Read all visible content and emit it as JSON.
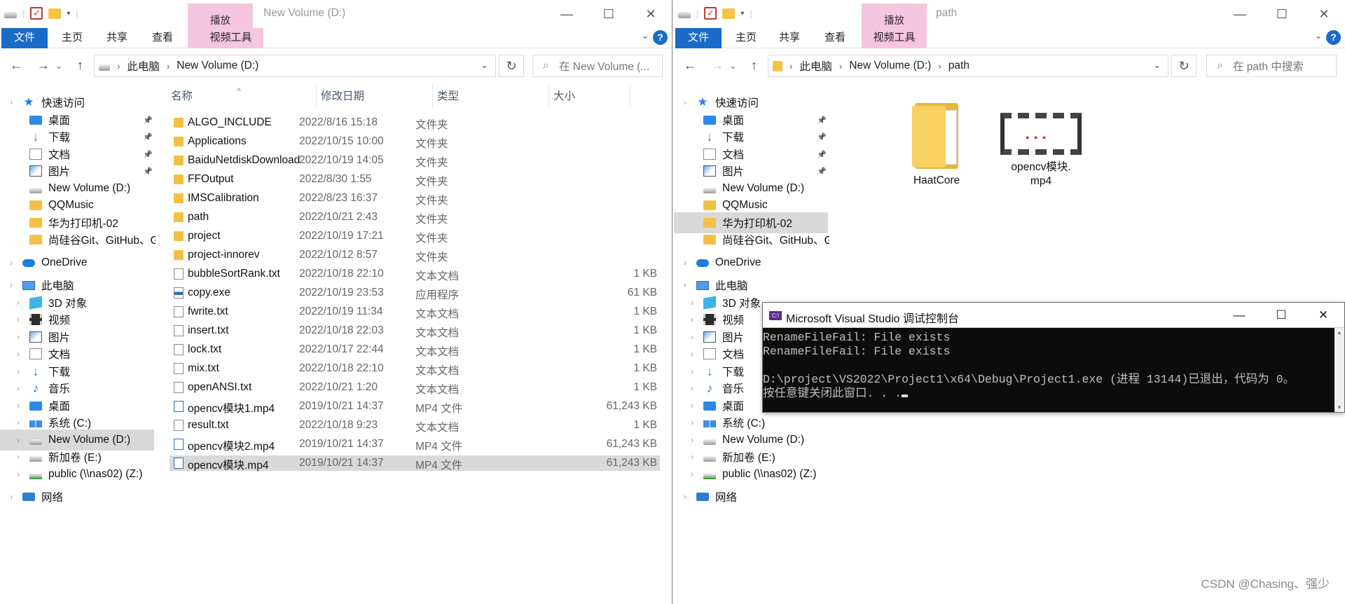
{
  "left": {
    "ribbon_context": "播放",
    "title": "New Volume (D:)",
    "tabs": [
      "文件",
      "主页",
      "共享",
      "查看",
      "视频工具"
    ],
    "breadcrumb": [
      "此电脑",
      "New Volume (D:)"
    ],
    "search_placeholder": "在 New Volume (...",
    "columns": {
      "name": "名称",
      "date": "修改日期",
      "type": "类型",
      "size": "大小"
    },
    "files": [
      {
        "name": "ALGO_INCLUDE",
        "date": "2022/8/16 15:18",
        "type": "文件夹",
        "size": "",
        "icon": "folder"
      },
      {
        "name": "Applications",
        "date": "2022/10/15 10:00",
        "type": "文件夹",
        "size": "",
        "icon": "folder"
      },
      {
        "name": "BaiduNetdiskDownload",
        "date": "2022/10/19 14:05",
        "type": "文件夹",
        "size": "",
        "icon": "folder"
      },
      {
        "name": "FFOutput",
        "date": "2022/8/30 1:55",
        "type": "文件夹",
        "size": "",
        "icon": "folder"
      },
      {
        "name": "IMSCalibration",
        "date": "2022/8/23 16:37",
        "type": "文件夹",
        "size": "",
        "icon": "folder"
      },
      {
        "name": "path",
        "date": "2022/10/21 2:43",
        "type": "文件夹",
        "size": "",
        "icon": "folder"
      },
      {
        "name": "project",
        "date": "2022/10/19 17:21",
        "type": "文件夹",
        "size": "",
        "icon": "folder"
      },
      {
        "name": "project-innorev",
        "date": "2022/10/12 8:57",
        "type": "文件夹",
        "size": "",
        "icon": "folder"
      },
      {
        "name": "bubbleSortRank.txt",
        "date": "2022/10/18 22:10",
        "type": "文本文档",
        "size": "1 KB",
        "icon": "txt"
      },
      {
        "name": "copy.exe",
        "date": "2022/10/19 23:53",
        "type": "应用程序",
        "size": "61 KB",
        "icon": "exe"
      },
      {
        "name": "fwrite.txt",
        "date": "2022/10/19 11:34",
        "type": "文本文档",
        "size": "1 KB",
        "icon": "txt"
      },
      {
        "name": "insert.txt",
        "date": "2022/10/18 22:03",
        "type": "文本文档",
        "size": "1 KB",
        "icon": "txt"
      },
      {
        "name": "lock.txt",
        "date": "2022/10/17 22:44",
        "type": "文本文档",
        "size": "1 KB",
        "icon": "txt"
      },
      {
        "name": "mix.txt",
        "date": "2022/10/18 22:10",
        "type": "文本文档",
        "size": "1 KB",
        "icon": "txt"
      },
      {
        "name": "openANSI.txt",
        "date": "2022/10/21 1:20",
        "type": "文本文档",
        "size": "1 KB",
        "icon": "txt"
      },
      {
        "name": "opencv模块1.mp4",
        "date": "2019/10/21 14:37",
        "type": "MP4 文件",
        "size": "61,243 KB",
        "icon": "mp4"
      },
      {
        "name": "result.txt",
        "date": "2022/10/18 9:23",
        "type": "文本文档",
        "size": "1 KB",
        "icon": "txt"
      },
      {
        "name": "opencv模块2.mp4",
        "date": "2019/10/21 14:37",
        "type": "MP4 文件",
        "size": "61,243 KB",
        "icon": "mp4"
      },
      {
        "name": "opencv模块.mp4",
        "date": "2019/10/21 14:37",
        "type": "MP4 文件",
        "size": "61,243 KB",
        "icon": "mp4",
        "selected": true
      }
    ],
    "nav": [
      {
        "label": "快速访问",
        "icon": "star",
        "level": 0,
        "expander": "›"
      },
      {
        "label": "桌面",
        "icon": "desk",
        "level": 1,
        "pin": true
      },
      {
        "label": "下载",
        "icon": "down",
        "level": 1,
        "pin": true
      },
      {
        "label": "文档",
        "icon": "doc",
        "level": 1,
        "pin": true
      },
      {
        "label": "图片",
        "icon": "pic",
        "level": 1,
        "pin": true
      },
      {
        "label": "New Volume (D:)",
        "icon": "drive",
        "level": 1
      },
      {
        "label": "QQMusic",
        "icon": "folder",
        "level": 1
      },
      {
        "label": "华为打印机-02",
        "icon": "folder",
        "level": 1
      },
      {
        "label": "尚硅谷Git、GitHub、Gitee码云",
        "icon": "folder",
        "level": 1
      },
      {
        "label": "OneDrive",
        "icon": "cloud",
        "level": 0,
        "expander": "›"
      },
      {
        "label": "此电脑",
        "icon": "pc",
        "level": 0,
        "expander": "›"
      },
      {
        "label": "3D 对象",
        "icon": "3d",
        "level": 1,
        "expander": "›"
      },
      {
        "label": "视频",
        "icon": "video",
        "level": 1,
        "expander": "›"
      },
      {
        "label": "图片",
        "icon": "pic",
        "level": 1,
        "expander": "›"
      },
      {
        "label": "文档",
        "icon": "doc",
        "level": 1,
        "expander": "›"
      },
      {
        "label": "下载",
        "icon": "down",
        "level": 1,
        "expander": "›"
      },
      {
        "label": "音乐",
        "icon": "music",
        "level": 1,
        "expander": "›"
      },
      {
        "label": "桌面",
        "icon": "desk",
        "level": 1,
        "expander": "›"
      },
      {
        "label": "系统 (C:)",
        "icon": "win",
        "level": 1,
        "expander": "›"
      },
      {
        "label": "New Volume (D:)",
        "icon": "drive",
        "level": 1,
        "expander": "›",
        "selected": true
      },
      {
        "label": "新加卷 (E:)",
        "icon": "drive",
        "level": 1,
        "expander": "›"
      },
      {
        "label": "public (\\\\nas02) (Z:)",
        "icon": "nas",
        "level": 1,
        "expander": "›"
      },
      {
        "label": "网络",
        "icon": "net",
        "level": 0,
        "expander": "›"
      }
    ]
  },
  "right": {
    "ribbon_context": "播放",
    "title": "path",
    "tabs": [
      "文件",
      "主页",
      "共享",
      "查看",
      "视频工具"
    ],
    "breadcrumb": [
      "此电脑",
      "New Volume (D:)",
      "path"
    ],
    "search_placeholder": "在 path 中搜索",
    "items": [
      {
        "name": "HaatCore",
        "icon": "folder"
      },
      {
        "name": "opencv模块.\nmp4",
        "icon": "video"
      }
    ],
    "nav": [
      {
        "label": "快速访问",
        "icon": "star",
        "level": 0,
        "expander": "›"
      },
      {
        "label": "桌面",
        "icon": "desk",
        "level": 1,
        "pin": true
      },
      {
        "label": "下载",
        "icon": "down",
        "level": 1,
        "pin": true
      },
      {
        "label": "文档",
        "icon": "doc",
        "level": 1,
        "pin": true
      },
      {
        "label": "图片",
        "icon": "pic",
        "level": 1,
        "pin": true
      },
      {
        "label": "New Volume (D:)",
        "icon": "drive",
        "level": 1
      },
      {
        "label": "QQMusic",
        "icon": "folder",
        "level": 1
      },
      {
        "label": "华为打印机-02",
        "icon": "folder",
        "level": 1,
        "selected": true
      },
      {
        "label": "尚硅谷Git、GitHub、Gitee码云",
        "icon": "folder",
        "level": 1
      },
      {
        "label": "OneDrive",
        "icon": "cloud",
        "level": 0,
        "expander": "›"
      },
      {
        "label": "此电脑",
        "icon": "pc",
        "level": 0,
        "expander": "›"
      },
      {
        "label": "3D 对象",
        "icon": "3d",
        "level": 1,
        "expander": "›"
      },
      {
        "label": "视频",
        "icon": "video",
        "level": 1,
        "expander": "›"
      },
      {
        "label": "图片",
        "icon": "pic",
        "level": 1,
        "expander": "›"
      },
      {
        "label": "文档",
        "icon": "doc",
        "level": 1,
        "expander": "›"
      },
      {
        "label": "下载",
        "icon": "down",
        "level": 1,
        "expander": "›"
      },
      {
        "label": "音乐",
        "icon": "music",
        "level": 1,
        "expander": "›"
      },
      {
        "label": "桌面",
        "icon": "desk",
        "level": 1,
        "expander": "›"
      },
      {
        "label": "系统 (C:)",
        "icon": "win",
        "level": 1,
        "expander": "›"
      },
      {
        "label": "New Volume (D:)",
        "icon": "drive",
        "level": 1,
        "expander": "›"
      },
      {
        "label": "新加卷 (E:)",
        "icon": "drive",
        "level": 1,
        "expander": "›"
      },
      {
        "label": "public (\\\\nas02) (Z:)",
        "icon": "nas",
        "level": 1,
        "expander": "›"
      },
      {
        "label": "网络",
        "icon": "net",
        "level": 0,
        "expander": "›"
      }
    ]
  },
  "console": {
    "title": "Microsoft Visual Studio 调试控制台",
    "icon_label": "C:\\",
    "lines": [
      "RenameFileFail: File exists",
      "RenameFileFail: File exists",
      "",
      "D:\\project\\VS2022\\Project1\\x64\\Debug\\Project1.exe (进程 13144)已退出，代码为 0。",
      "按任意键关闭此窗口. . ."
    ]
  },
  "watermark": "CSDN @Chasing、强少"
}
